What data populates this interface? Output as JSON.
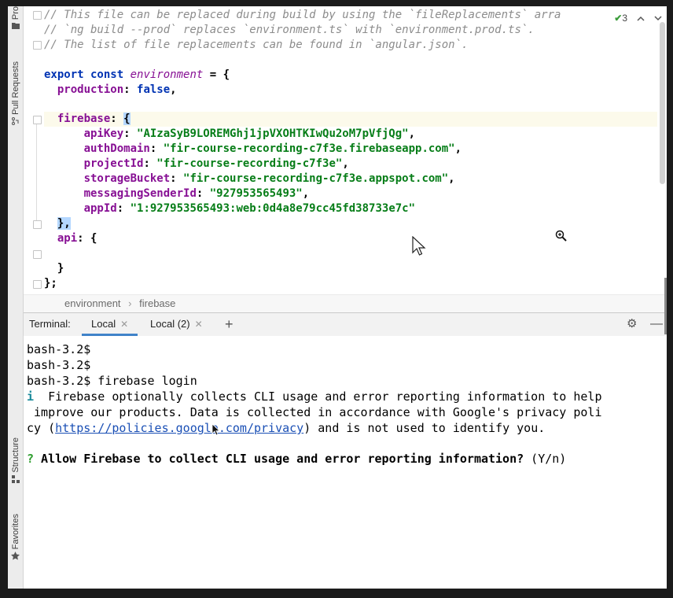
{
  "sidebar": {
    "project_label": "Pro",
    "pull_requests_label": "Pull Requests",
    "structure_label": "Structure",
    "favorites_label": "Favorites"
  },
  "editor": {
    "inspections_count": "3",
    "lines": {
      "c1": "// This file can be replaced during build by using the `fileReplacements` arra",
      "c2": "// `ng build --prod` replaces `environment.ts` with `environment.prod.ts`.",
      "c3": "// The list of file replacements can be found in `angular.json`.",
      "export_kw": "export const",
      "env_name": "environment",
      "env_open": " = {",
      "production_key": "production",
      "production_val": "false",
      "firebase_key": "firebase",
      "apikey_key": "apiKey",
      "apikey_val": "\"AIzaSyB9LOREMGhj1jpVXOHTKIwQu2oM7pVfjQg\"",
      "authdomain_key": "authDomain",
      "authdomain_val": "\"fir-course-recording-c7f3e.firebaseapp.com\"",
      "projectid_key": "projectId",
      "projectid_val": "\"fir-course-recording-c7f3e\"",
      "storage_key": "storageBucket",
      "storage_val": "\"fir-course-recording-c7f3e.appspot.com\"",
      "sender_key": "messagingSenderId",
      "sender_val": "\"927953565493\"",
      "appid_key": "appId",
      "appid_val": "\"1:927953565493:web:0d4a8e79cc45fd38733e7c\"",
      "close_obj": "},",
      "api_key": "api",
      "api_open": "{",
      "api_close": "}",
      "end": "};"
    }
  },
  "breadcrumb": [
    "environment",
    "firebase"
  ],
  "terminal_header": {
    "title": "Terminal:",
    "tabs": [
      {
        "label": "Local",
        "active": true
      },
      {
        "label": "Local (2)",
        "active": false
      }
    ],
    "add": "+"
  },
  "terminal": {
    "line1": "bash-3.2$",
    "line2": "bash-3.2$",
    "line3": "bash-3.2$ firebase login",
    "info_mark": "i",
    "info1": "  Firebase optionally collects CLI usage and error reporting information to help",
    "info2": " improve our products. Data is collected in accordance with Google's privacy poli",
    "info3_pre": "cy (",
    "info3_link": "https://policies.google.com/privacy",
    "info3_post": ") and is not used to identify you.",
    "question_mark": "?",
    "question": " Allow Firebase to collect CLI usage and error reporting information?",
    "question_opts": " (Y/n)"
  },
  "colors": {
    "accent_tab": "#4083c9",
    "keyword": "#0033b3",
    "string": "#067d17",
    "property": "#871094",
    "info": "#1a8a9a",
    "question": "#2e9e2e"
  }
}
